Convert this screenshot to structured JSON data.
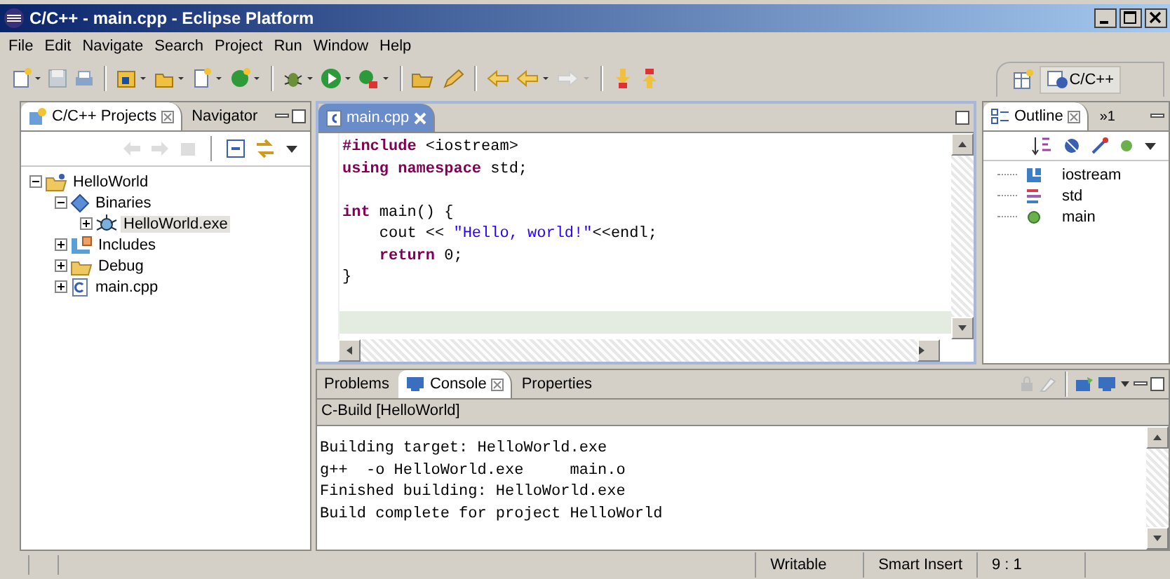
{
  "window": {
    "title": "C/C++ - main.cpp - Eclipse Platform"
  },
  "menu": [
    "File",
    "Edit",
    "Navigate",
    "Search",
    "Project",
    "Run",
    "Window",
    "Help"
  ],
  "perspective": {
    "label": "C/C++",
    "selected": true
  },
  "projects_panel": {
    "tabs": [
      {
        "label": "C/C++ Projects",
        "selected": true
      },
      {
        "label": "Navigator",
        "selected": false
      }
    ],
    "tree": [
      {
        "label": "HelloWorld",
        "kind": "project",
        "expanded": true,
        "selected": false,
        "children": [
          {
            "label": "Binaries",
            "kind": "binaries",
            "expanded": true,
            "selected": false,
            "children": [
              {
                "label": "HelloWorld.exe",
                "kind": "exe",
                "expanded": false,
                "selected": true
              }
            ]
          },
          {
            "label": "Includes",
            "kind": "includes",
            "expanded": false,
            "selected": false
          },
          {
            "label": "Debug",
            "kind": "folder",
            "expanded": false,
            "selected": false
          },
          {
            "label": "main.cpp",
            "kind": "cfile",
            "expanded": false,
            "selected": false
          }
        ]
      }
    ]
  },
  "editor": {
    "tab": "main.cpp",
    "line_highlight": true,
    "code_blocks": [
      [
        [
          {
            "text": "#include",
            "kind": "keyword"
          },
          {
            "text": " <iostream>",
            "kind": "plain"
          }
        ],
        [
          {
            "text": "using namespace",
            "kind": "keyword"
          },
          {
            "text": " std;",
            "kind": "plain"
          }
        ]
      ],
      [
        [
          {
            "text": "int",
            "kind": "keyword"
          },
          {
            "text": " main() {",
            "kind": "plain"
          }
        ],
        [
          {
            "text": "    cout << ",
            "kind": "plain"
          },
          {
            "text": "\"Hello, world!\"",
            "kind": "string"
          },
          {
            "text": "<<endl;",
            "kind": "plain"
          }
        ],
        [
          {
            "text": "    return",
            "kind": "keyword"
          },
          {
            "text": " 0;",
            "kind": "plain"
          }
        ],
        [
          {
            "text": "}",
            "kind": "plain"
          }
        ]
      ]
    ]
  },
  "outline": {
    "tab": "Outline",
    "overflow": "»1",
    "items": [
      {
        "label": "iostream",
        "kind": "include"
      },
      {
        "label": "std",
        "kind": "namespace"
      },
      {
        "label": "main",
        "kind": "function"
      }
    ]
  },
  "bottom_panel": {
    "tabs": [
      {
        "label": "Problems",
        "selected": false
      },
      {
        "label": "Console",
        "selected": true
      },
      {
        "label": "Properties",
        "selected": false
      }
    ],
    "console_title": "C-Build [HelloWorld]",
    "console_lines": [
      "Building target: HelloWorld.exe",
      "g++  -o HelloWorld.exe     main.o",
      "Finished building: HelloWorld.exe",
      "Build complete for project HelloWorld"
    ]
  },
  "status_bar": [
    "Writable",
    "Smart Insert",
    "9 : 1"
  ]
}
